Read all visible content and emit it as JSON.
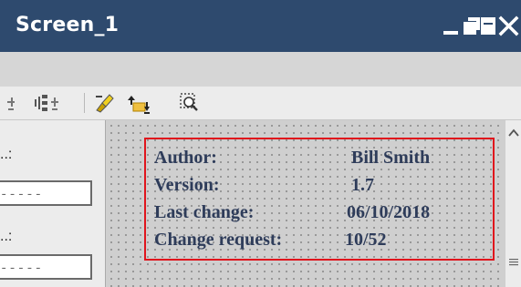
{
  "window": {
    "title": "Screen_1"
  },
  "left_panel": {
    "label_1": "..:",
    "field_1_value": "-----",
    "label_2": "..:",
    "field_2_value": "-----"
  },
  "info_box": {
    "rows": [
      {
        "label": "Author:",
        "value": "Bill Smith"
      },
      {
        "label": "Version:",
        "value": "1.7"
      },
      {
        "label": "Last change:",
        "value": "06/10/2018"
      },
      {
        "label": "Change request:",
        "value": "10/52"
      }
    ]
  },
  "colors": {
    "titlebar": "#2e4a6e",
    "highlight_border": "#e0141c",
    "info_text": "#2e3c5a"
  },
  "icons": [
    "minimize-icon",
    "restore-icon",
    "maximize-icon",
    "close-icon",
    "distribute-horizontal-icon",
    "distribute-vertical-icon",
    "format-painter-icon",
    "bring-to-front-icon",
    "zoom-selection-icon",
    "scroll-up-icon",
    "scroll-grip-icon"
  ]
}
